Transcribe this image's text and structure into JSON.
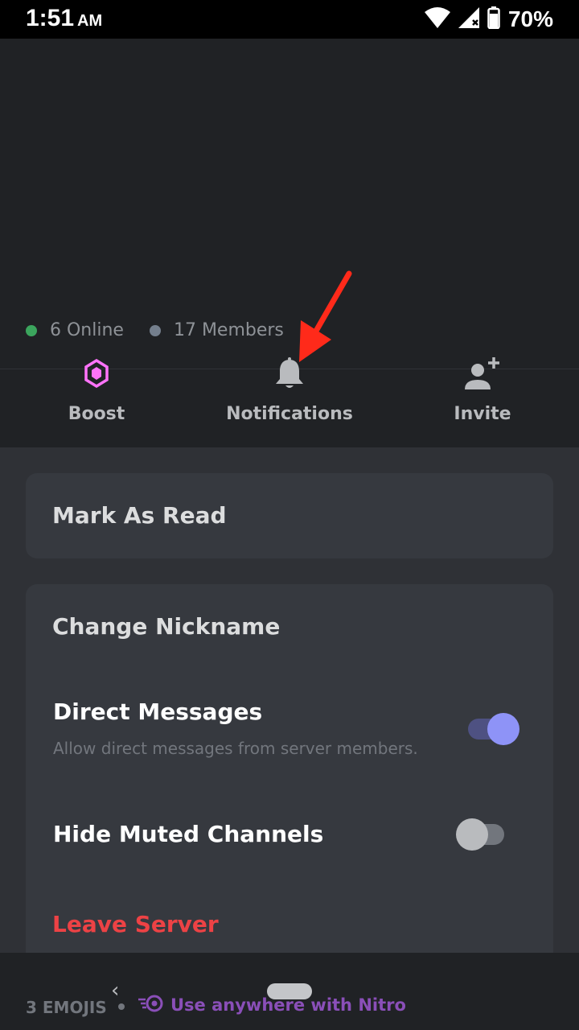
{
  "status_bar": {
    "time": "1:51",
    "ampm": "AM",
    "battery": "70%"
  },
  "server": {
    "online_text": "6 Online",
    "members_text": "17 Members"
  },
  "actions": [
    {
      "label": "Boost",
      "icon": "boost-gem-icon"
    },
    {
      "label": "Notifications",
      "icon": "bell-icon"
    },
    {
      "label": "Invite",
      "icon": "add-user-icon"
    }
  ],
  "menu": {
    "mark_as_read": "Mark As Read",
    "change_nickname": "Change Nickname",
    "direct_messages": {
      "title": "Direct Messages",
      "subtitle": "Allow direct messages from server members.",
      "enabled": true
    },
    "hide_muted": {
      "title": "Hide Muted Channels",
      "enabled": false
    },
    "leave_server": "Leave Server"
  },
  "bottom": {
    "emoji_count": "3 EMOJIS",
    "nitro_text": "Use anywhere with Nitro"
  },
  "colors": {
    "accent": "#8e93f7",
    "danger": "#ed4245",
    "boost": "#ff73fa",
    "online": "#3ba55d",
    "annotation": "#ff2a1a"
  }
}
